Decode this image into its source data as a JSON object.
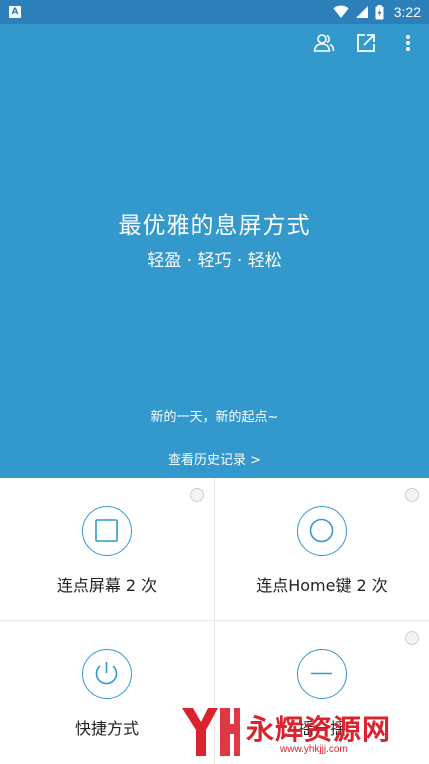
{
  "status_bar": {
    "notification_icon": "A",
    "time": "3:22"
  },
  "header": {
    "actions": [
      "people-icon",
      "share-icon",
      "more-icon"
    ]
  },
  "hero": {
    "title": "最优雅的息屏方式",
    "subtitle": "轻盈 · 轻巧 · 轻松",
    "greeting": "新的一天，新的起点~",
    "history_link": "查看历史记录 >"
  },
  "options": [
    {
      "label": "连点屏幕 2 次",
      "icon": "square-icon"
    },
    {
      "label": "连点Home键 2 次",
      "icon": "home-circle-icon"
    },
    {
      "label": "快捷方式",
      "icon": "power-icon"
    },
    {
      "label": "摇一摇",
      "icon": "minus-icon"
    }
  ],
  "watermark": {
    "text": "永辉资源网",
    "url": "www.yhkjjj.com"
  },
  "colors": {
    "accent": "#3399cc",
    "status_bar": "#2c7fb8",
    "watermark": "#d9232e"
  }
}
